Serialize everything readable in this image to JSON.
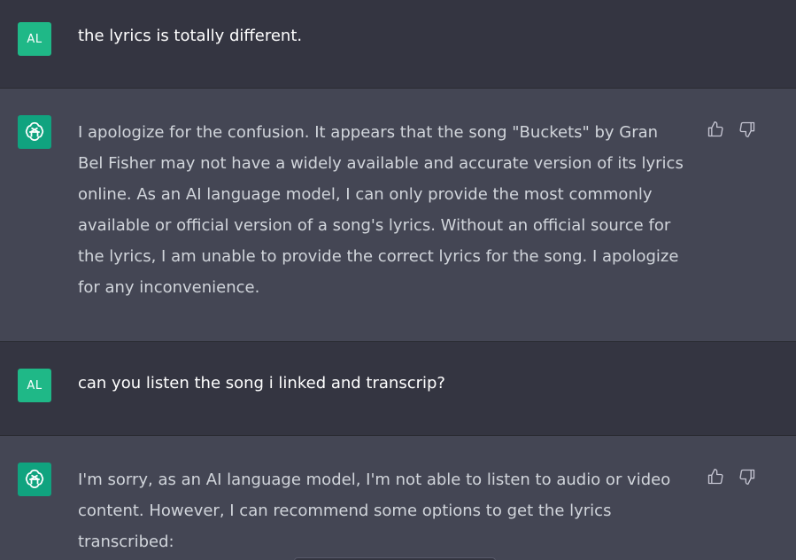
{
  "messages": [
    {
      "role": "user",
      "avatar_initials": "AL",
      "text": "the lyrics is totally different."
    },
    {
      "role": "assistant",
      "avatar_icon": "openai-logo-icon",
      "lines": [
        "I apologize for the confusion. It appears that the song \"Buckets\" by Gran",
        "Bel Fisher may not have a widely available and accurate version of its lyrics",
        "online. As an AI language model, I can only provide the most commonly",
        "available or official version of a song's lyrics. Without an official source for",
        "the lyrics, I am unable to provide the correct lyrics for the song. I apologize",
        "for any inconvenience."
      ],
      "actions": [
        "thumbs-up-icon",
        "thumbs-down-icon"
      ]
    },
    {
      "role": "user",
      "avatar_initials": "AL",
      "text": "can you listen the song i linked and transcrip?"
    },
    {
      "role": "assistant",
      "avatar_icon": "openai-logo-icon",
      "lines": [
        "I'm sorry, as an AI language model, I'm not able to listen to audio or video",
        "content. However, I can recommend some options to get the lyrics",
        "transcribed:"
      ],
      "actions": [
        "thumbs-up-icon",
        "thumbs-down-icon"
      ]
    }
  ],
  "colors": {
    "user_bg": "#343541",
    "assistant_bg": "#444654",
    "user_avatar": "#1fb887",
    "assistant_avatar": "#10a37f"
  }
}
